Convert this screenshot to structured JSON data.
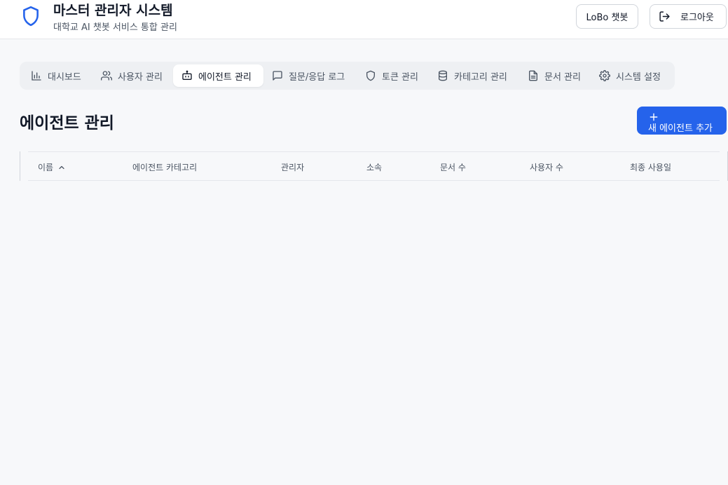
{
  "header": {
    "title": "마스터 관리자 시스템",
    "subtitle": "대학교 AI 챗봇 서비스 통합 관리",
    "chatbot_button": "LoBo 챗봇",
    "logout_button": "로그아웃"
  },
  "tabs": [
    {
      "label": "대시보드",
      "icon": "bar-chart-icon"
    },
    {
      "label": "사용자 관리",
      "icon": "users-icon"
    },
    {
      "label": "에이전트 관리",
      "icon": "bot-icon",
      "active": true
    },
    {
      "label": "질문/응답 로그",
      "icon": "message-square-icon"
    },
    {
      "label": "토큰 관리",
      "icon": "shield-icon"
    },
    {
      "label": "카테고리 관리",
      "icon": "database-icon"
    },
    {
      "label": "문서 관리",
      "icon": "file-text-icon"
    },
    {
      "label": "시스템 설정",
      "icon": "gear-icon"
    }
  ],
  "main": {
    "title": "에이전트 관리",
    "add_button": "새 에이전트 추가"
  },
  "table": {
    "columns": [
      "이름",
      "에이전트 카테고리",
      "관리자",
      "소속",
      "문서 수",
      "사용자 수",
      "최종 사용일"
    ],
    "sorted_column": "이름",
    "sort_direction": "ascending",
    "rows": []
  },
  "colors": {
    "accent": "#2563eb",
    "background": "#f7f8fa"
  }
}
